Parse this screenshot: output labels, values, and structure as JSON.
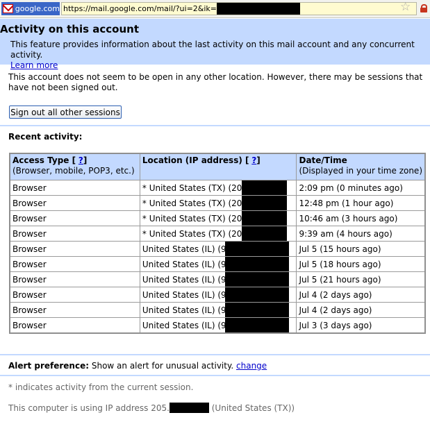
{
  "browser": {
    "site_label": "google.com",
    "url": "https://mail.google.com/mail/?ui=2&ik="
  },
  "header": {
    "title": "Activity on this account",
    "description": "This feature provides information about the last activity on this mail account and any concurrent activity.",
    "learn_more": "Learn more"
  },
  "status_text": "This account does not seem to be open in any other location. However, there may be sessions that have not been signed out.",
  "signout_button": "Sign out all other sessions",
  "recent_activity_label": "Recent activity:",
  "table": {
    "headers": {
      "access_type": "Access Type [",
      "access_type_help": "?",
      "access_type_close": "]",
      "access_type_sub": "(Browser, mobile, POP3, etc.)",
      "location": "Location (IP address) [",
      "location_help": "?",
      "location_close": "]",
      "datetime": "Date/Time",
      "datetime_sub": "(Displayed in your time zone)"
    },
    "rows": [
      {
        "access": "Browser",
        "location": "* United States (TX) (205.1",
        "datetime": "2:09 pm (0 minutes ago)"
      },
      {
        "access": "Browser",
        "location": "* United States (TX) (205.1",
        "datetime": "12:48 pm (1 hour ago)"
      },
      {
        "access": "Browser",
        "location": "* United States (TX) (205.1",
        "datetime": "10:46 am (3 hours ago)"
      },
      {
        "access": "Browser",
        "location": "* United States (TX) (205.1",
        "datetime": "9:39 am (4 hours ago)"
      },
      {
        "access": "Browser",
        "location": "United States (IL) (98",
        "datetime": "Jul 5 (15 hours ago)"
      },
      {
        "access": "Browser",
        "location": "United States (IL) (98",
        "datetime": "Jul 5 (18 hours ago)"
      },
      {
        "access": "Browser",
        "location": "United States (IL) (98",
        "datetime": "Jul 5 (21 hours ago)"
      },
      {
        "access": "Browser",
        "location": "United States (IL) (98",
        "datetime": "Jul 4 (2 days ago)"
      },
      {
        "access": "Browser",
        "location": "United States (IL) (98",
        "datetime": "Jul 4 (2 days ago)"
      },
      {
        "access": "Browser",
        "location": "United States (IL) (98",
        "datetime": "Jul 3 (3 days ago)"
      }
    ]
  },
  "alert": {
    "label": "Alert preference:",
    "text": "Show an alert for unusual activity.",
    "change_link": "change"
  },
  "footnote": "* indicates activity from the current session.",
  "ip_line": {
    "prefix": "This computer is using IP address 205.",
    "suffix": "(United States (TX))"
  },
  "colors": {
    "header_bg": "#c3d9ff",
    "link": "#0000cc",
    "redaction": "#000000"
  }
}
